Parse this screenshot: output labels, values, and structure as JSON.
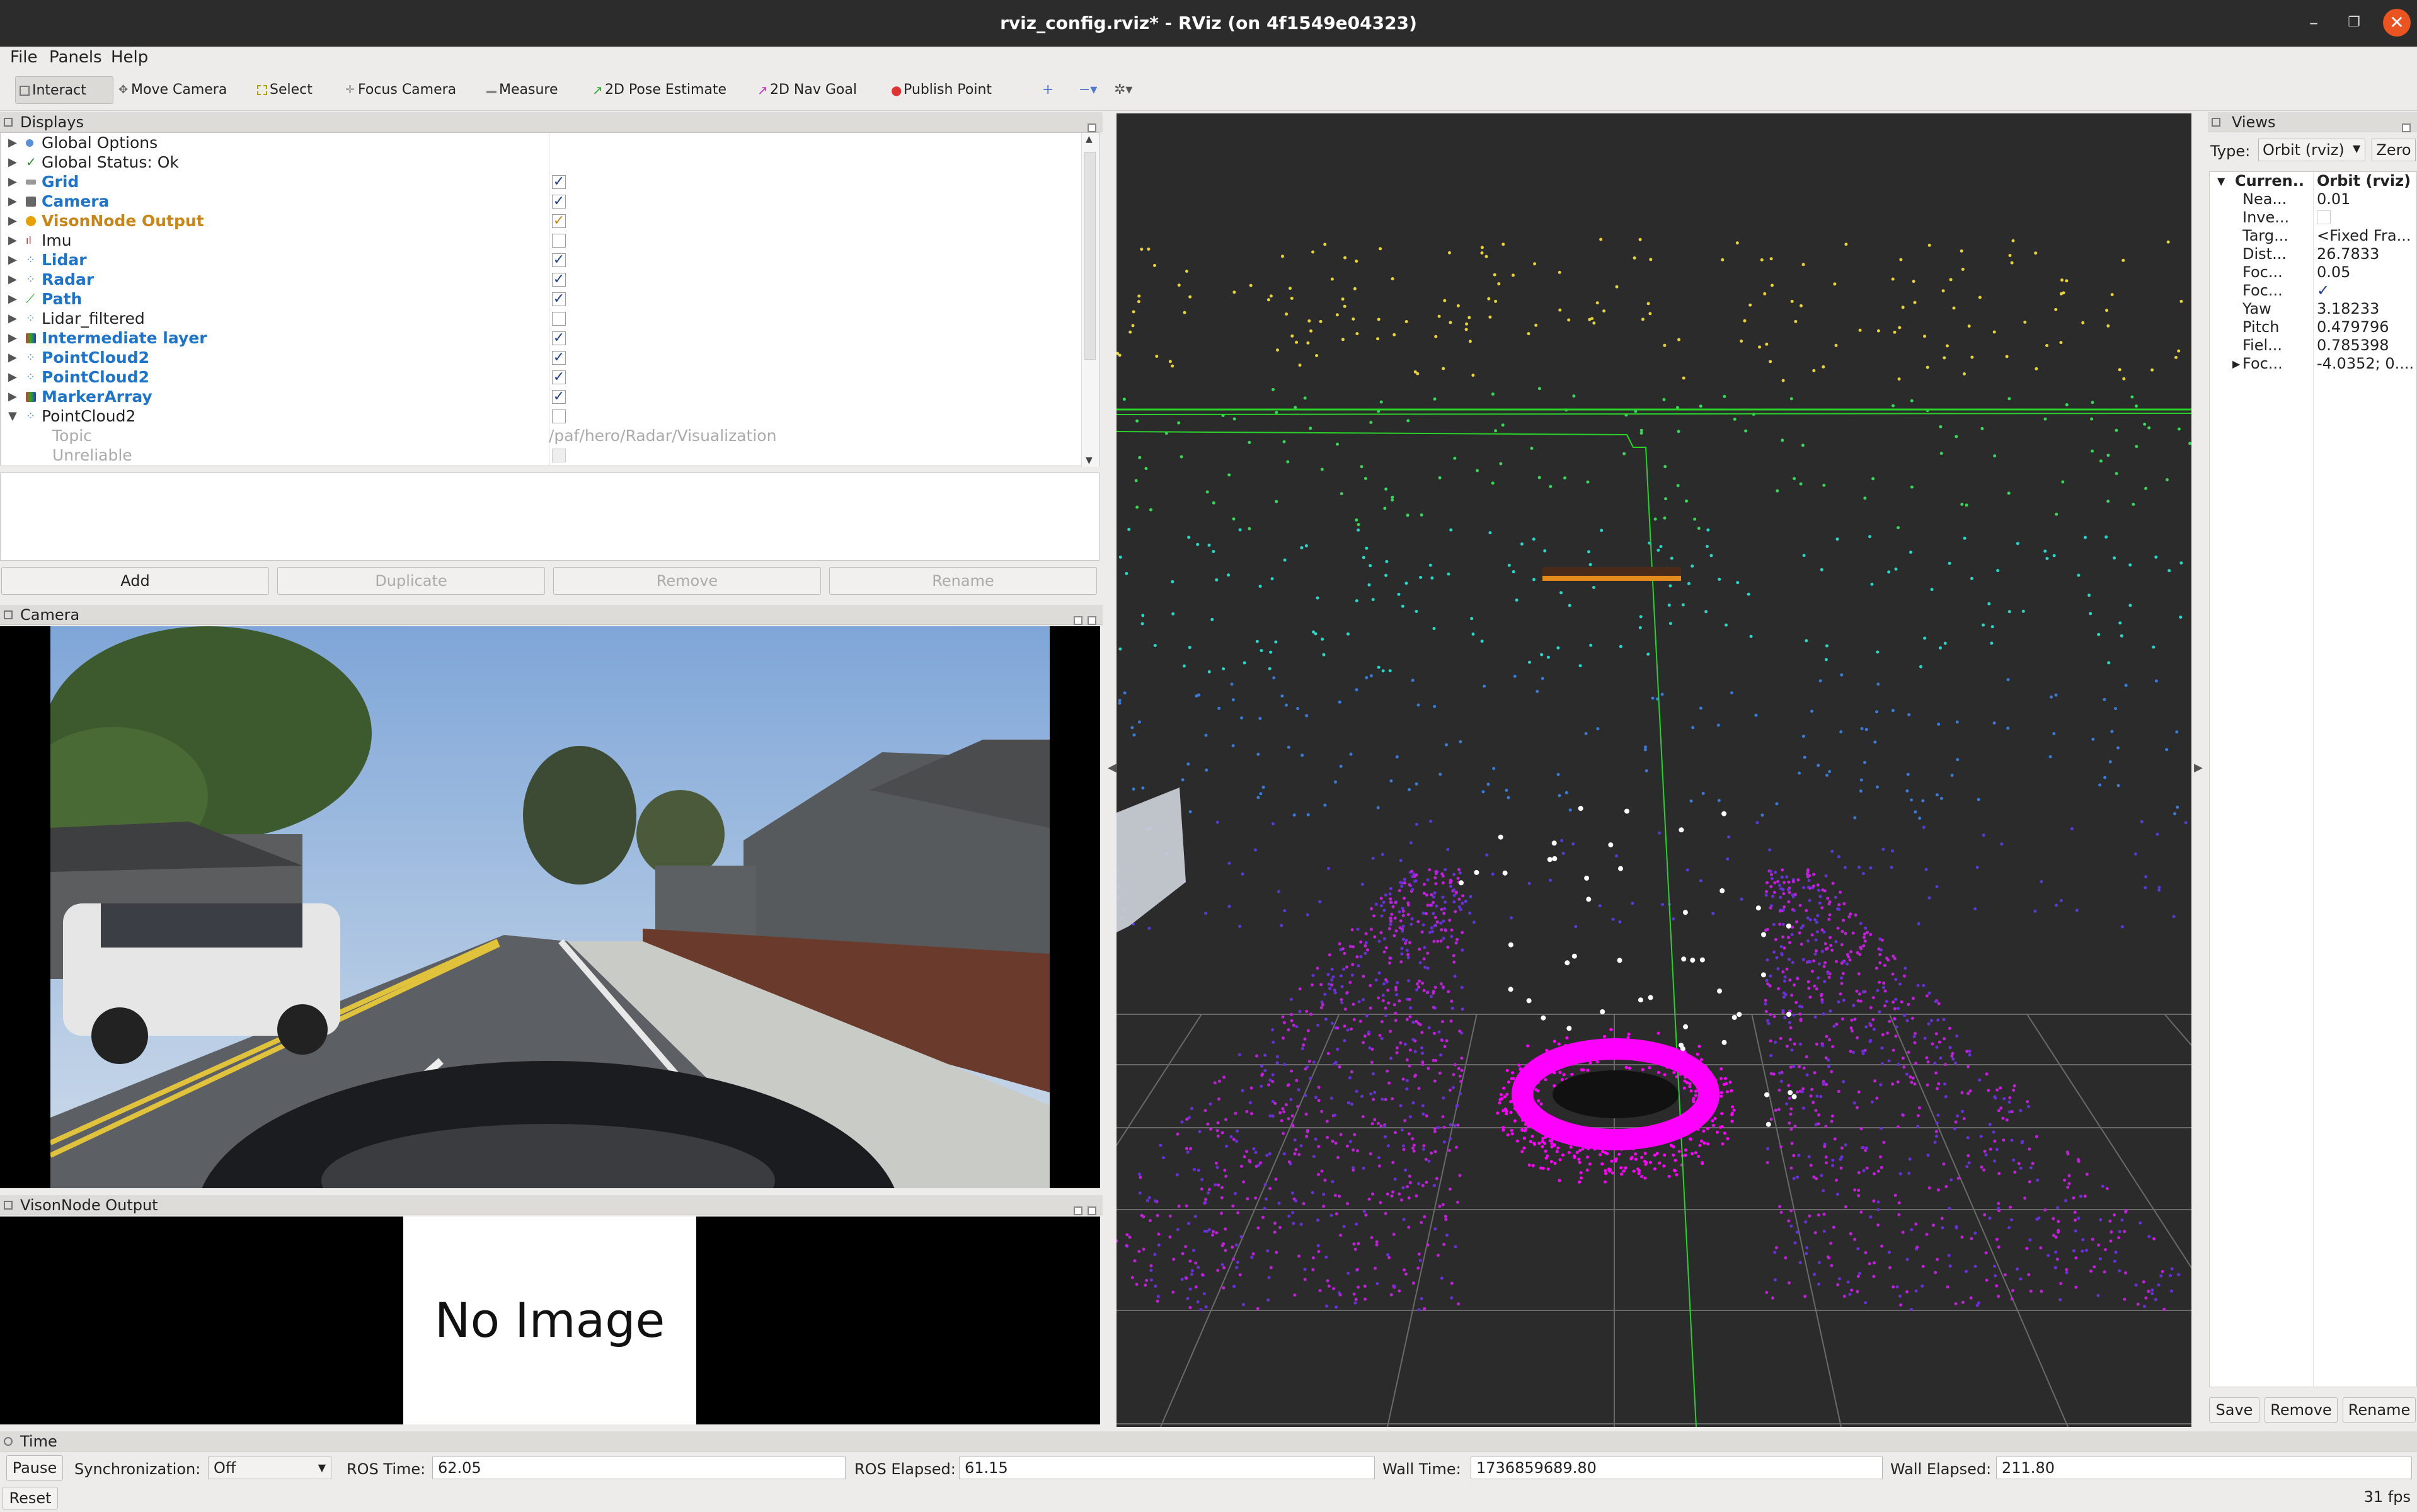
{
  "window": {
    "title": "rviz_config.rviz* - RViz (on 4f1549e04323)"
  },
  "menu": [
    "File",
    "Panels",
    "Help"
  ],
  "toolbar": {
    "tools": [
      "Interact",
      "Move Camera",
      "Select",
      "Focus Camera",
      "Measure",
      "2D Pose Estimate",
      "2D Nav Goal",
      "Publish Point"
    ]
  },
  "displays": {
    "title": "Displays",
    "items": [
      {
        "label": "Global Options",
        "checked": null
      },
      {
        "label": "Global Status: Ok",
        "checked": null
      },
      {
        "label": "Grid",
        "checked": true
      },
      {
        "label": "Camera",
        "checked": true
      },
      {
        "label": "VisonNode Output",
        "checked": true
      },
      {
        "label": "Imu",
        "checked": false
      },
      {
        "label": "Lidar",
        "checked": true
      },
      {
        "label": "Radar",
        "checked": true
      },
      {
        "label": "Path",
        "checked": true
      },
      {
        "label": "Lidar_filtered",
        "checked": false
      },
      {
        "label": "Intermediate layer",
        "checked": true
      },
      {
        "label": "PointCloud2",
        "checked": true
      },
      {
        "label": "PointCloud2",
        "checked": true
      },
      {
        "label": "MarkerArray",
        "checked": true
      },
      {
        "label": "PointCloud2",
        "checked": false
      }
    ],
    "topic_label": "Topic",
    "topic_value": "/paf/hero/Radar/Visualization",
    "unreliable_label": "Unreliable",
    "buttons": {
      "add": "Add",
      "duplicate": "Duplicate",
      "remove": "Remove",
      "rename": "Rename"
    }
  },
  "camera_panel": {
    "title": "Camera"
  },
  "vison_panel": {
    "title": "VisonNode Output",
    "no_image": "No Image"
  },
  "views": {
    "title": "Views",
    "type_label": "Type:",
    "type_value": "Orbit (rviz)",
    "zero": "Zero",
    "current_key": "Curren...",
    "current_val": "Orbit (rviz)",
    "rows": [
      {
        "k": "Nea...",
        "v": "0.01"
      },
      {
        "k": "Inve...",
        "v": ""
      },
      {
        "k": "Targ...",
        "v": "<Fixed Fra..."
      },
      {
        "k": "Dist...",
        "v": "26.7833"
      },
      {
        "k": "Foc...",
        "v": "0.05"
      },
      {
        "k": "Foc...",
        "v": "✓"
      },
      {
        "k": "Yaw",
        "v": "3.18233"
      },
      {
        "k": "Pitch",
        "v": "0.479796"
      },
      {
        "k": "Fiel...",
        "v": "0.785398"
      },
      {
        "k": "Foc...",
        "v": "-4.0352; 0...."
      }
    ],
    "buttons": {
      "save": "Save",
      "remove": "Remove",
      "rename": "Rename"
    }
  },
  "time": {
    "title": "Time",
    "pause": "Pause",
    "sync_label": "Synchronization:",
    "sync_value": "Off",
    "ros_time_label": "ROS Time:",
    "ros_time": "62.05",
    "ros_elapsed_label": "ROS Elapsed:",
    "ros_elapsed": "61.15",
    "wall_time_label": "Wall Time:",
    "wall_time": "1736859689.80",
    "wall_elapsed_label": "Wall Elapsed:",
    "wall_elapsed": "211.80",
    "reset": "Reset",
    "fps": "31 fps"
  },
  "colors": {
    "accent_blue": "#1f74c8",
    "warning_orange": "#c7861a",
    "pointcloud_magenta": "#ff00ff",
    "grid_green": "#1fd41f"
  }
}
